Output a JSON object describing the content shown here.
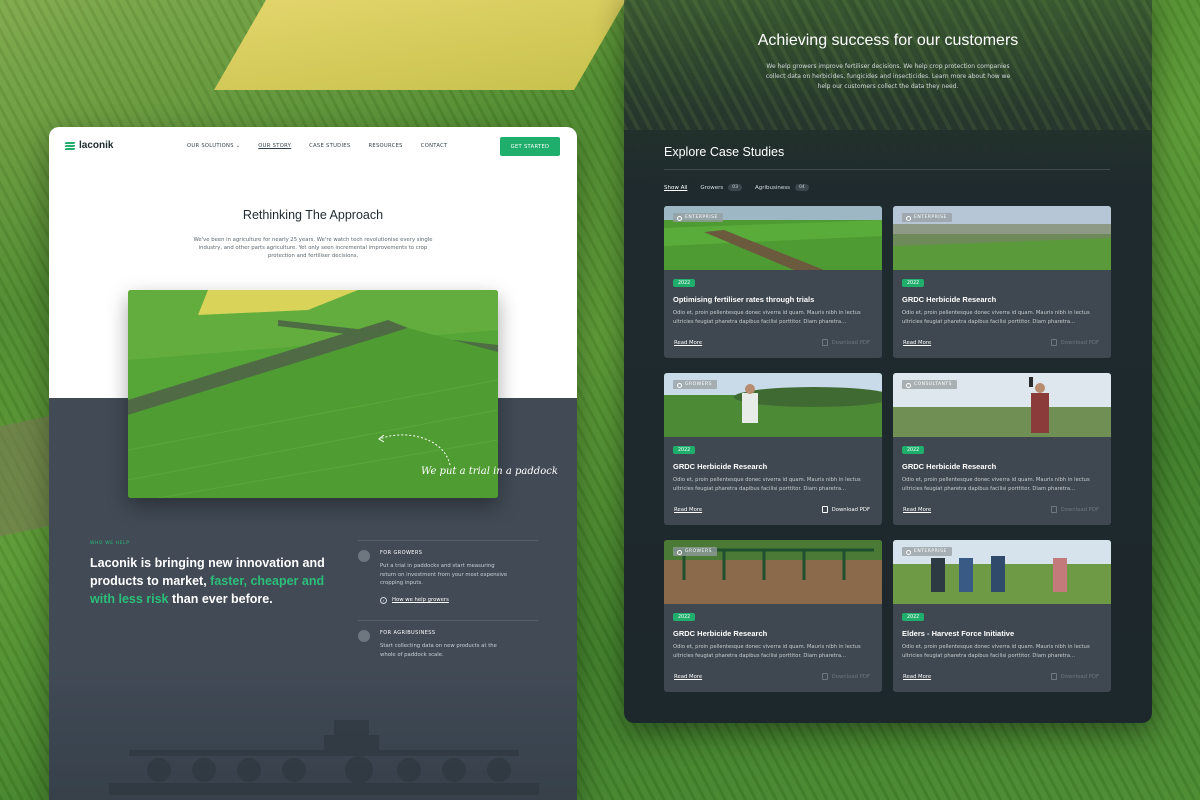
{
  "left_page": {
    "logo": "laconik",
    "nav": {
      "items": [
        "OUR SOLUTIONS",
        "OUR STORY",
        "CASE STUDIES",
        "RESOURCES",
        "CONTACT"
      ],
      "active": "OUR STORY",
      "cta": "GET STARTED"
    },
    "hero": {
      "title": "Rethinking The Approach",
      "text": "We've been in agriculture for nearly 25 years. We're watch tech revolutionise every single industry, and other parts agriculture. Yet only seen incremental improvements to crop protection and fertiliser decisions.",
      "annotation": "We put a trial in a paddock"
    },
    "who": {
      "label": "WHO WE HELP",
      "title_part1": "Laconik is bringing new innovation and products to market, ",
      "title_accent": "faster, cheaper and with less risk",
      "title_part2": " than ever before.",
      "items": [
        {
          "heading": "FOR GROWERS",
          "desc": "Put a trial in paddocks and start measuring return on investment from your most expensive cropping inputs.",
          "link": "How we help growers"
        },
        {
          "heading": "FOR AGRIBUSINESS",
          "desc": "Start collecting data on new products at the whole of paddock scale."
        }
      ]
    }
  },
  "right_page": {
    "title": "Achieving success for our customers",
    "subtitle": "We help growers improve fertiliser decisions. We help crop protection companies collect data on herbicides, fungicides and insecticides. Learn more about how we  help our customers collect the data they need.",
    "explore_title": "Explore Case Studies",
    "filters": [
      {
        "label": "Show All"
      },
      {
        "label": "Growers",
        "count": "03"
      },
      {
        "label": "Agribusiness",
        "count": "04"
      }
    ],
    "cards": [
      {
        "badge": "ENTERPRISE",
        "year": "2022",
        "title": "Optimising fertiliser rates through trials",
        "desc": "Odio et, proin pellentesque donec viverra id quam. Mauris nibh in lectus ultricies feugiat pharetra dapibus facilisi porttitor. Diam pharetra...",
        "read": "Read More",
        "download": "Download PDF",
        "download_enabled": false
      },
      {
        "badge": "ENTERPRISE",
        "year": "2022",
        "title": "GRDC Herbicide Research",
        "desc": "Odio et, proin pellentesque donec viverra id quam. Mauris nibh in lectus ultricies feugiat pharetra dapibus facilisi porttitor. Diam pharetra...",
        "read": "Read More",
        "download": "Download PDF",
        "download_enabled": false
      },
      {
        "badge": "GROWERS",
        "year": "2022",
        "title": "GRDC Herbicide Research",
        "desc": "Odio et, proin pellentesque donec viverra id quam. Mauris nibh in lectus ultricies feugiat pharetra dapibus facilisi porttitor. Diam pharetra...",
        "read": "Read More",
        "download": "Download PDF",
        "download_enabled": true
      },
      {
        "badge": "CONSULTANTS",
        "year": "2022",
        "title": "GRDC Herbicide Research",
        "desc": "Odio et, proin pellentesque donec viverra id quam. Mauris nibh in lectus ultricies feugiat pharetra dapibus facilisi porttitor. Diam pharetra...",
        "read": "Read More",
        "download": "Download PDF",
        "download_enabled": false
      },
      {
        "badge": "GROWERS",
        "year": "2022",
        "title": "GRDC Herbicide Research",
        "desc": "Odio et, proin pellentesque donec viverra id quam. Mauris nibh in lectus ultricies feugiat pharetra dapibus facilisi porttitor. Diam pharetra...",
        "read": "Read More",
        "download": "Download PDF",
        "download_enabled": false
      },
      {
        "badge": "ENTERPRISE",
        "year": "2022",
        "title": "Elders - Harvest Force Initiative",
        "desc": "Odio et, proin pellentesque donec viverra id quam. Mauris nibh in lectus ultricies feugiat pharetra dapibus facilisi porttitor. Diam pharetra...",
        "read": "Read More",
        "download": "Download PDF",
        "download_enabled": false
      }
    ]
  },
  "colors": {
    "brand_green": "#1fae6b",
    "dark_slate": "#414a55",
    "panel_dark": "#1f2a2e"
  },
  "icons": [
    "logo-mark-icon",
    "chevron-down-icon",
    "tag-icon",
    "document-download-icon",
    "arrow-right-circle-icon",
    "help-category-icon"
  ]
}
